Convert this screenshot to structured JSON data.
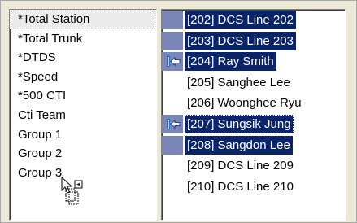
{
  "groups": [
    {
      "label": "*Total Station"
    },
    {
      "label": "*Total Trunk"
    },
    {
      "label": "*DTDS"
    },
    {
      "label": "*Speed"
    },
    {
      "label": "*500 CTI"
    },
    {
      "label": "Cti Team"
    },
    {
      "label": "Group 1"
    },
    {
      "label": "Group 2"
    },
    {
      "label": "Group 3"
    }
  ],
  "stations": [
    {
      "label": "[202] DCS Line 202",
      "selected": true,
      "icon": ""
    },
    {
      "label": "[203] DCS Line 203",
      "selected": true,
      "icon": ""
    },
    {
      "label": "[204] Ray Smith",
      "selected": true,
      "icon": "call-forward-icon"
    },
    {
      "label": "[205] Sanghee Lee",
      "selected": false,
      "icon": ""
    },
    {
      "label": "[206] Woonghee Ryu",
      "selected": false,
      "icon": ""
    },
    {
      "label": "[207] Sungsik Jung",
      "selected": true,
      "icon": "call-forward-icon",
      "focused": true
    },
    {
      "label": "[208] Sangdon Lee",
      "selected": true,
      "icon": ""
    },
    {
      "label": "[209] DCS Line 209",
      "selected": false,
      "icon": ""
    },
    {
      "label": "[210] DCS Line 210",
      "selected": false,
      "icon": ""
    }
  ],
  "colors": {
    "selection": "#0a246a",
    "selection_icon_cell": "#7a86b7",
    "window_bg": "#ece9d8"
  },
  "cursor": {
    "icon": "drag-copy-cursor-icon"
  }
}
